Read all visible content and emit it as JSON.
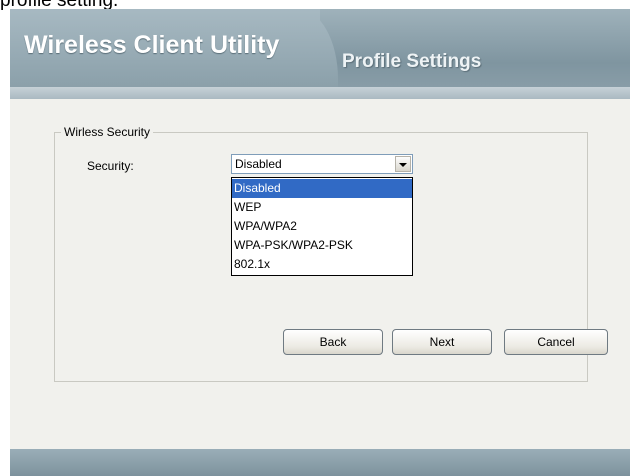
{
  "caption": "profile setting.",
  "header": {
    "app_title": "Wireless Client Utility",
    "page_title": "Profile Settings"
  },
  "security_group": {
    "legend": "Wirless Security",
    "security_label": "Security:",
    "select": {
      "value": "Disabled",
      "options": [
        "Disabled",
        "WEP",
        "WPA/WPA2",
        "WPA-PSK/WPA2-PSK",
        "802.1x"
      ],
      "highlighted_option": "Disabled"
    }
  },
  "buttons": {
    "back": "Back",
    "next": "Next",
    "cancel": "Cancel"
  },
  "colors": {
    "header": "#8da1ab",
    "selection": "#316ac5",
    "panel": "#f1f1ed"
  }
}
